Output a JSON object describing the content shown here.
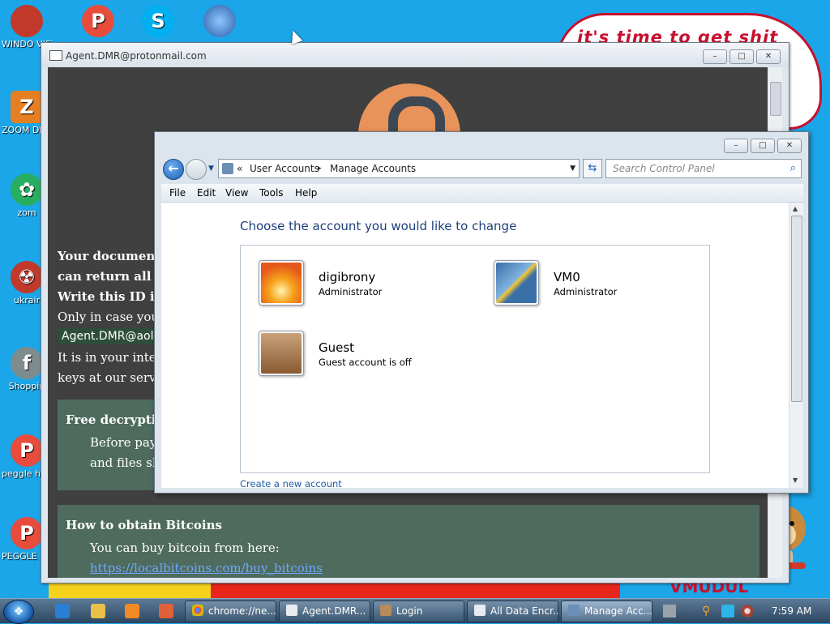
{
  "desktop": {
    "bubble_text": "it's time to get shit",
    "wall_text": "VMUDUL",
    "icons": [
      {
        "label": "WINDO VISTA",
        "icon": "windows-orb-icon",
        "color": "#c0392b"
      },
      {
        "label": "ZOOM DELUX",
        "icon": "zoom-game-icon",
        "color": "#e67e22"
      },
      {
        "label": "zom",
        "icon": "flower-icon",
        "color": "#27ae60"
      },
      {
        "label": "ukrair",
        "icon": "radiation-icon",
        "color": "#c0392b"
      },
      {
        "label": "Shoppin",
        "icon": "flash-icon",
        "color": "#7f8c8d"
      },
      {
        "label": "peggle hegg",
        "icon": "peggle-icon",
        "color": "#e74c3c"
      },
      {
        "label": "PEGGLE NECKBE",
        "icon": "peggle-icon",
        "color": "#e74c3c"
      }
    ],
    "top_icons": [
      {
        "icon": "peggle-icon",
        "color": "#e74c3c",
        "text": "P"
      },
      {
        "icon": "skype-icon",
        "color": "#00aff0",
        "text": "S"
      },
      {
        "icon": "globe-icon",
        "color": "#2a5da8",
        "text": ""
      }
    ]
  },
  "ransom_window": {
    "title": "Agent.DMR@protonmail.com",
    "buttons": {
      "minimize": "–",
      "maximize": "□",
      "close": "✕"
    },
    "lines": [
      "Your documents",
      "can return all yo",
      "Write this ID in t",
      "Only in case you d"
    ],
    "id_email": "Agent.DMR@aol.c",
    "lines2": [
      "It is in your interes",
      "keys at our server"
    ],
    "free_panel": {
      "title": "Free decryptio",
      "line1": "Before payin",
      "line2": "and files sho"
    },
    "bitcoin_panel": {
      "title": "How to obtain Bitcoins",
      "line1": "You can buy bitcoin from here:",
      "link": "https://localbitcoins.com/buy_bitcoins"
    }
  },
  "control_panel": {
    "breadcrumb": {
      "prefix": "«",
      "items": [
        "User Accounts",
        "Manage Accounts"
      ],
      "sep": "▸"
    },
    "search_placeholder": "Search Control Panel",
    "menu": [
      "File",
      "Edit",
      "View",
      "Tools",
      "Help"
    ],
    "heading": "Choose the account you would like to change",
    "accounts": [
      {
        "name": "digibrony",
        "role": "Administrator",
        "picture": "orange-flower-picture"
      },
      {
        "name": "VM0",
        "role": "Administrator",
        "picture": "leaf-picture"
      },
      {
        "name": "Guest",
        "role": "Guest account is off",
        "picture": "briefcase-picture"
      }
    ],
    "create_link": "Create a new account"
  },
  "taskbar": {
    "buttons": [
      {
        "label": "chrome://ne...",
        "icon": "chrome-icon"
      },
      {
        "label": "Agent.DMR...",
        "icon": "window-icon"
      },
      {
        "label": "Login",
        "icon": "login-icon"
      },
      {
        "label": "All Data Encr...",
        "icon": "window-icon"
      },
      {
        "label": "Manage Acc...",
        "icon": "control-panel-icon"
      }
    ],
    "clock": "7:59 AM"
  }
}
